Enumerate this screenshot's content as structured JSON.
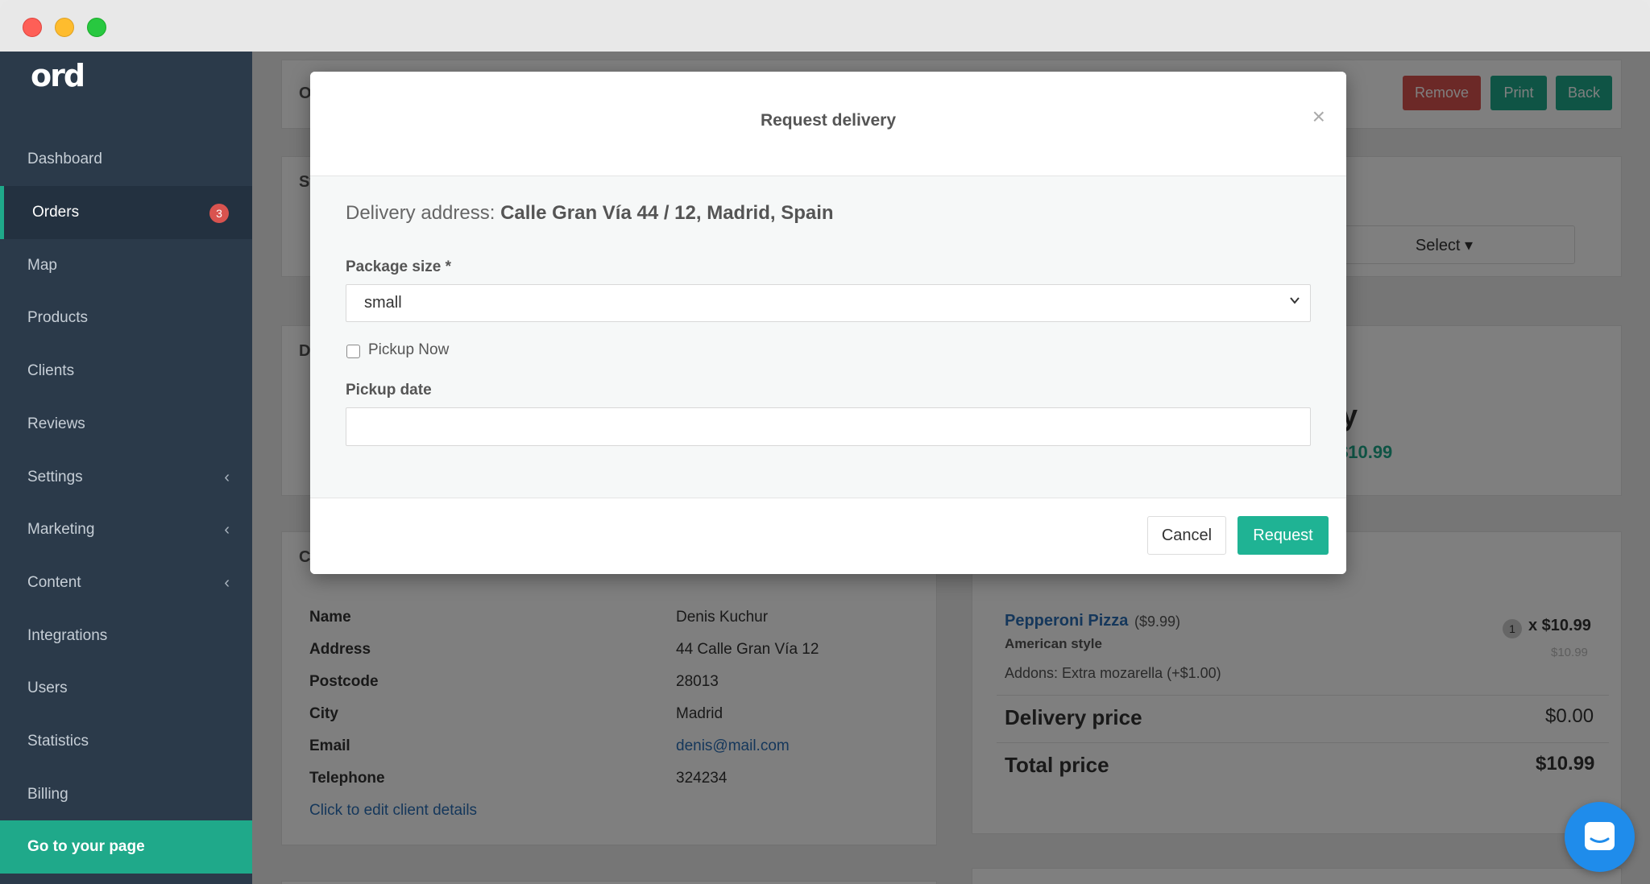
{
  "app": {
    "logo": "ord"
  },
  "sidebar": {
    "items": [
      {
        "label": "Dashboard"
      },
      {
        "label": "Orders",
        "badge": "3"
      },
      {
        "label": "Map"
      },
      {
        "label": "Products"
      },
      {
        "label": "Clients"
      },
      {
        "label": "Reviews"
      },
      {
        "label": "Settings",
        "chevron": "‹"
      },
      {
        "label": "Marketing",
        "chevron": "‹"
      },
      {
        "label": "Content",
        "chevron": "‹"
      },
      {
        "label": "Integrations"
      },
      {
        "label": "Users"
      },
      {
        "label": "Statistics"
      },
      {
        "label": "Billing"
      }
    ],
    "cta": "Go to your page"
  },
  "header_actions": {
    "remove": "Remove",
    "print": "Print",
    "back": "Back"
  },
  "background": {
    "partial_o": "O",
    "partial_st": "St",
    "partial_d": "D",
    "partial_cl": "Cl",
    "partial_y": "y",
    "select_label": "Select ▾",
    "price_partial": "$10.99"
  },
  "client": {
    "rows": [
      {
        "label": "Name",
        "value": "Denis Kuchur"
      },
      {
        "label": "Address",
        "value": "44 Calle Gran Vía 12"
      },
      {
        "label": "Postcode",
        "value": "28013"
      },
      {
        "label": "City",
        "value": "Madrid"
      },
      {
        "label": "Email",
        "value": "denis@mail.com"
      },
      {
        "label": "Telephone",
        "value": "324234"
      }
    ],
    "edit_link": "Click to edit client details"
  },
  "order": {
    "item_name": "Pepperoni Pizza",
    "item_price": "($9.99)",
    "item_style": "American style",
    "addons": "Addons: Extra mozarella (+$1.00)",
    "qty": "1",
    "line_total": "x $10.99",
    "line_sub": "$10.99",
    "delivery_label": "Delivery price",
    "delivery_value": "$0.00",
    "total_label": "Total price",
    "total_value": "$10.99"
  },
  "modal": {
    "title": "Request delivery",
    "close": "×",
    "address_label": "Delivery address:",
    "address_value": "Calle Gran Vía 44 / 12, Madrid, Spain",
    "package_label": "Package size *",
    "package_value": "small",
    "pickup_now_label": "Pickup Now",
    "pickup_now_checked": false,
    "pickup_date_label": "Pickup date",
    "pickup_date_value": "",
    "cancel": "Cancel",
    "request": "Request"
  },
  "colors": {
    "accent": "#1fa98a",
    "danger": "#d9534f",
    "sidebar": "#2b3a4a",
    "link": "#2a6fb6"
  }
}
